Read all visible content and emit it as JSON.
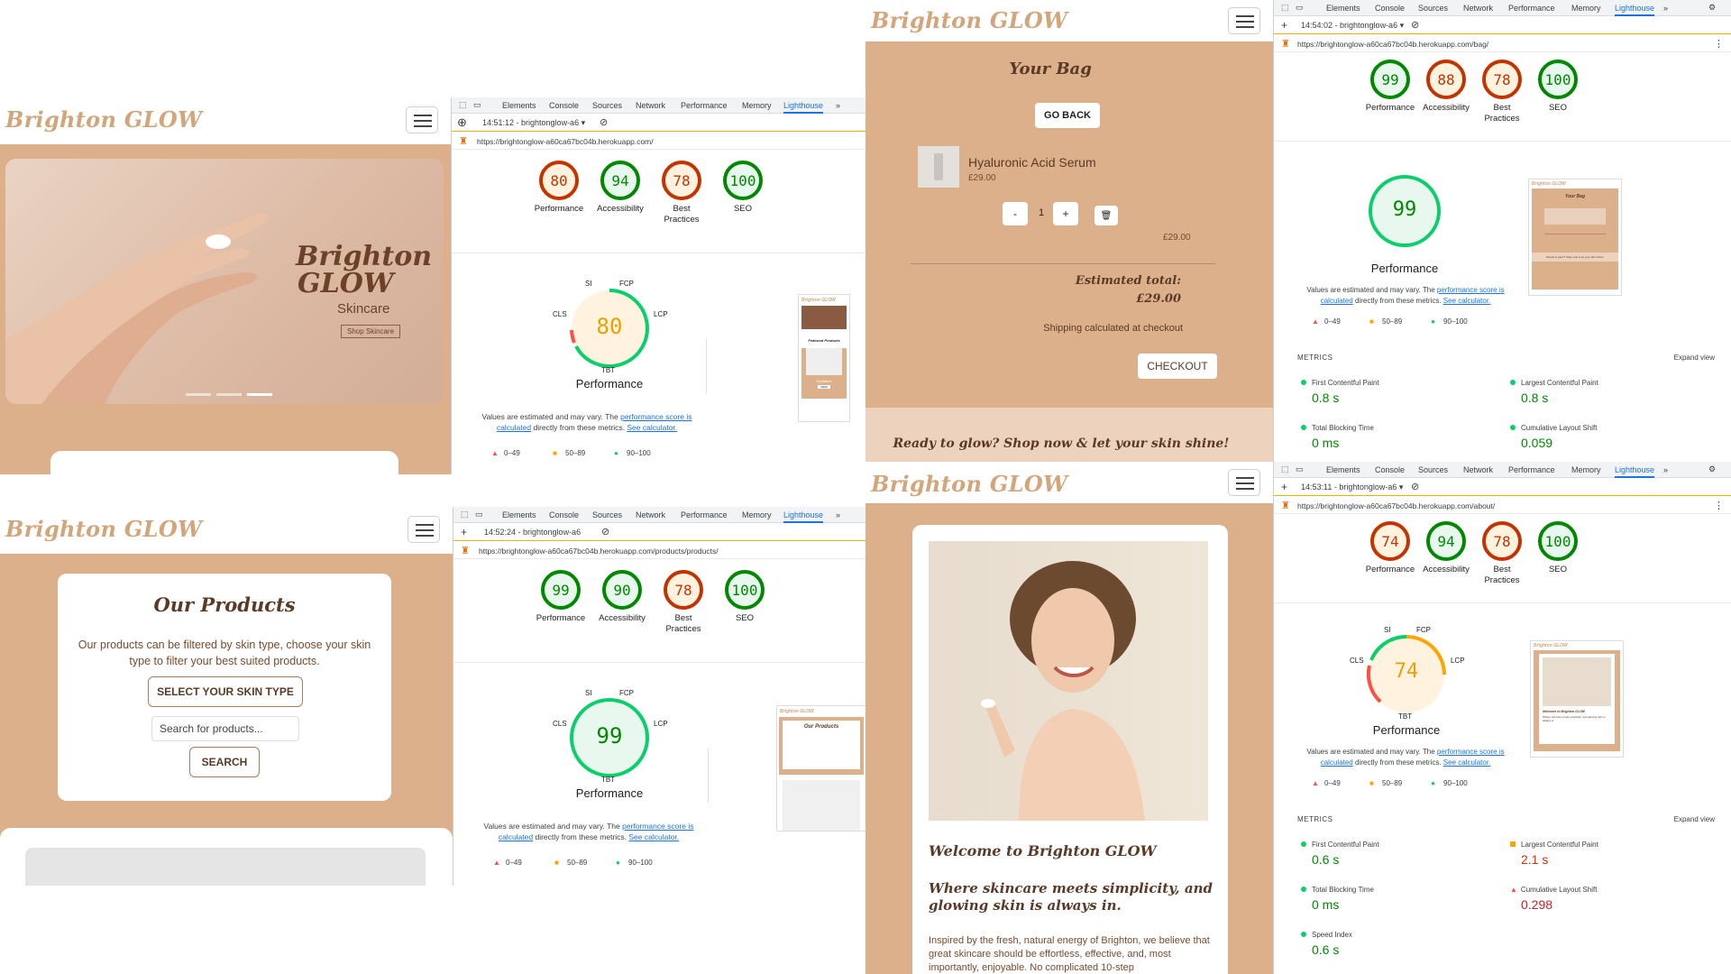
{
  "brand": {
    "name": "Brighton GLOW",
    "accent": "#dcb08a",
    "dark": "#5a3a26"
  },
  "devtools_tabs": [
    "Elements",
    "Console",
    "Sources",
    "Network",
    "Performance",
    "Memory",
    "Lighthouse",
    "»"
  ],
  "legend": {
    "bad": "0–49",
    "avg": "50–89",
    "good": "90–100"
  },
  "note": {
    "pre": "Values are estimated and may vary. The ",
    "link1": "performance score is calculated",
    "mid": " directly from these metrics. ",
    "link2": "See calculator."
  },
  "labels": {
    "performance": "Performance",
    "accessibility": "Accessibility",
    "best": "Best Practices",
    "seo": "SEO",
    "metrics": "METRICS",
    "expand": "Expand view"
  },
  "home": {
    "time": "14:51:12 - brightonglow-a6 ▾",
    "url": "https://brightonglow-a60ca67bc04b.herokuapp.com/",
    "scores": [
      80,
      94,
      78,
      100
    ],
    "hero_title_1": "Brighton",
    "hero_title_2": "GLOW",
    "hero_sub": "Skincare",
    "hero_btn": "Shop Skincare",
    "gauge_labels": [
      "SI",
      "FCP",
      "LCP",
      "TBT",
      "CLS"
    ],
    "big": 80,
    "thumb_title": "Brighton GLOW",
    "thumb_featured": "Featured Products",
    "thumb_item": "Hydration",
    "thumb_btn": "VIEW"
  },
  "products": {
    "time": "14:52:24 - brightonglow-a6",
    "url": "https://brightonglow-a60ca67bc04b.herokuapp.com/products/products/",
    "scores": [
      99,
      90,
      78,
      100
    ],
    "title": "Our Products",
    "desc": "Our products can be filtered by skin type, choose your skin type to filter your best suited products.",
    "select_btn": "SELECT YOUR SKIN TYPE",
    "search_placeholder": "Search for products...",
    "search_btn": "SEARCH",
    "big": 99,
    "thumb_title": "Brighton GLOW",
    "thumb_heading": "Our Products"
  },
  "bag": {
    "time": "14:54:02 - brightonglow-a6 ▾",
    "url": "https://brightonglow-a60ca67bc04b.herokuapp.com/bag/",
    "scores": [
      99,
      88,
      78,
      100
    ],
    "title": "Your Bag",
    "back": "GO BACK",
    "item_name": "Hyaluronic Acid Serum",
    "item_price": "£29.00",
    "minus": "-",
    "qty": "1",
    "plus": "+",
    "line_total": "£29.00",
    "est_label": "Estimated total:",
    "est_value": "£29.00",
    "shipping": "Shipping calculated at checkout",
    "checkout": "CHECKOUT",
    "banner": "Ready to glow? Shop now & let your skin shine!",
    "big": 99,
    "thumb_title": "Brighton GLOW",
    "thumb_heading": "Your Bag",
    "thumb_banner": "Ready to glow? Shop now & let your skin shine!",
    "metrics": [
      {
        "name": "First Contentful Paint",
        "value": "0.8 s",
        "status": "good"
      },
      {
        "name": "Largest Contentful Paint",
        "value": "0.8 s",
        "status": "good"
      },
      {
        "name": "Total Blocking Time",
        "value": "0 ms",
        "status": "good"
      },
      {
        "name": "Cumulative Layout Shift",
        "value": "0.059",
        "status": "good"
      }
    ]
  },
  "about": {
    "time": "14:53:11 - brightonglow-a6 ▾",
    "url": "https://brightonglow-a60ca67bc04b.herokuapp.com/about/",
    "scores": [
      74,
      94,
      78,
      100
    ],
    "welcome": "Welcome to Brighton GLOW",
    "tagline": "Where skincare meets simplicity, and glowing skin is always in.",
    "body": "Inspired by the fresh, natural energy of Brighton, we believe that great skincare should be effortless, effective, and, most importantly, enjoyable. No complicated 10-step",
    "big": 74,
    "thumb_title": "Brighton GLOW",
    "thumb_welcome": "Welcome to Brighton GLOW",
    "thumb_tagline": "Where skincare meets simplicity, and glowing skin is always in.",
    "metrics": [
      {
        "name": "First Contentful Paint",
        "value": "0.6 s",
        "status": "good"
      },
      {
        "name": "Largest Contentful Paint",
        "value": "2.1 s",
        "status": "avg"
      },
      {
        "name": "Total Blocking Time",
        "value": "0 ms",
        "status": "good"
      },
      {
        "name": "Cumulative Layout Shift",
        "value": "0.298",
        "status": "bad"
      },
      {
        "name": "Speed Index",
        "value": "0.6 s",
        "status": "good"
      }
    ]
  }
}
